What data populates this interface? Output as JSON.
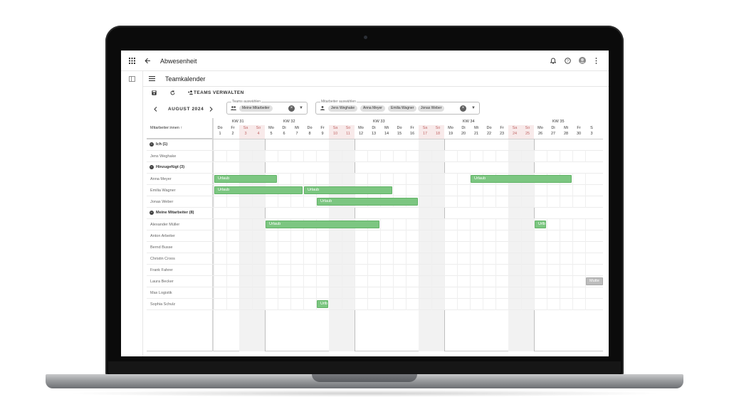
{
  "app": {
    "title": "Abwesenheit",
    "page_title": "Teamkalender",
    "icons": [
      "apps-icon",
      "back-icon",
      "bell-icon",
      "help-icon",
      "avatar",
      "more-icon",
      "sidebar-toggle-icon",
      "menu-icon",
      "save-icon",
      "refresh-icon",
      "group-add-icon"
    ]
  },
  "toolbar": {
    "teams_button": "TEAMS VERWALTEN",
    "month": "AUGUST 2024"
  },
  "teams_select": {
    "label": "Teams auswählen",
    "chips": [
      "Meine Mitarbeiter"
    ]
  },
  "staff_select": {
    "label": "Mitarbeiter auswählen",
    "chips": [
      "Jens Weghake",
      "Anna Meyer",
      "Emilia Wagner",
      "Jonas Weber"
    ]
  },
  "calendar": {
    "column_header": "Mitarbeiter:innen ↑",
    "weeks": [
      {
        "label": "KW 31",
        "start_index": 0
      },
      {
        "label": "KW 32",
        "start_index": 4
      },
      {
        "label": "KW 33",
        "start_index": 11
      },
      {
        "label": "KW 34",
        "start_index": 18
      },
      {
        "label": "KW 35",
        "start_index": 25
      }
    ],
    "days": [
      {
        "wd": "Do",
        "d": "1"
      },
      {
        "wd": "Fr",
        "d": "2"
      },
      {
        "wd": "Sa",
        "d": "3"
      },
      {
        "wd": "So",
        "d": "4"
      },
      {
        "wd": "Mo",
        "d": "5"
      },
      {
        "wd": "Di",
        "d": "6"
      },
      {
        "wd": "Mi",
        "d": "7"
      },
      {
        "wd": "Do",
        "d": "8"
      },
      {
        "wd": "Fr",
        "d": "9"
      },
      {
        "wd": "Sa",
        "d": "10"
      },
      {
        "wd": "So",
        "d": "11"
      },
      {
        "wd": "Mo",
        "d": "12"
      },
      {
        "wd": "Di",
        "d": "13"
      },
      {
        "wd": "Mi",
        "d": "14"
      },
      {
        "wd": "Do",
        "d": "15"
      },
      {
        "wd": "Fr",
        "d": "16"
      },
      {
        "wd": "Sa",
        "d": "17"
      },
      {
        "wd": "So",
        "d": "18"
      },
      {
        "wd": "Mo",
        "d": "19"
      },
      {
        "wd": "Di",
        "d": "20"
      },
      {
        "wd": "Mi",
        "d": "21"
      },
      {
        "wd": "Do",
        "d": "22"
      },
      {
        "wd": "Fr",
        "d": "23"
      },
      {
        "wd": "Sa",
        "d": "24"
      },
      {
        "wd": "So",
        "d": "25"
      },
      {
        "wd": "Mo",
        "d": "26"
      },
      {
        "wd": "Di",
        "d": "27"
      },
      {
        "wd": "Mi",
        "d": "28"
      },
      {
        "wd": "Fr",
        "d": "30"
      },
      {
        "wd": "S",
        "d": "3"
      }
    ],
    "rows": [
      {
        "type": "group",
        "label": "Ich (1)"
      },
      {
        "type": "person",
        "name": "Jens Weghake",
        "absences": []
      },
      {
        "type": "group",
        "label": "Hinzugefügt (3)"
      },
      {
        "type": "person",
        "name": "Anna Meyer",
        "absences": [
          {
            "label": "Urlaub",
            "from": 1,
            "to": 5
          },
          {
            "label": "Urlaub",
            "from": 21,
            "to": 28
          }
        ]
      },
      {
        "type": "person",
        "name": "Emilia Wagner",
        "absences": [
          {
            "label": "Urlaub",
            "from": 1,
            "to": 7
          },
          {
            "label": "Urlaub",
            "from": 8,
            "to": 14
          }
        ]
      },
      {
        "type": "person",
        "name": "Jonas Weber",
        "absences": [
          {
            "label": "Urlaub",
            "from": 9,
            "to": 16
          }
        ]
      },
      {
        "type": "group",
        "label": "Meine Mitarbeiter (8)"
      },
      {
        "type": "person",
        "name": "Alexander Müller",
        "absences": [
          {
            "label": "Urlaub",
            "from": 5,
            "to": 13
          },
          {
            "label": "Urlb",
            "from": 26,
            "to": 26
          }
        ]
      },
      {
        "type": "person",
        "name": "Anton Arbeiter",
        "absences": []
      },
      {
        "type": "person",
        "name": "Bernd Busse",
        "absences": []
      },
      {
        "type": "person",
        "name": "Christin Croos",
        "absences": []
      },
      {
        "type": "person",
        "name": "Frank Fahrer",
        "absences": []
      },
      {
        "type": "person",
        "name": "Laura Becker",
        "absences": [
          {
            "label": "Mutte",
            "from": 30,
            "to": 31,
            "style": "grey"
          }
        ]
      },
      {
        "type": "person",
        "name": "Max Logistik",
        "absences": []
      },
      {
        "type": "person",
        "name": "Sophia Schulz",
        "absences": [
          {
            "label": "Urlb",
            "from": 9,
            "to": 9
          }
        ]
      }
    ]
  }
}
